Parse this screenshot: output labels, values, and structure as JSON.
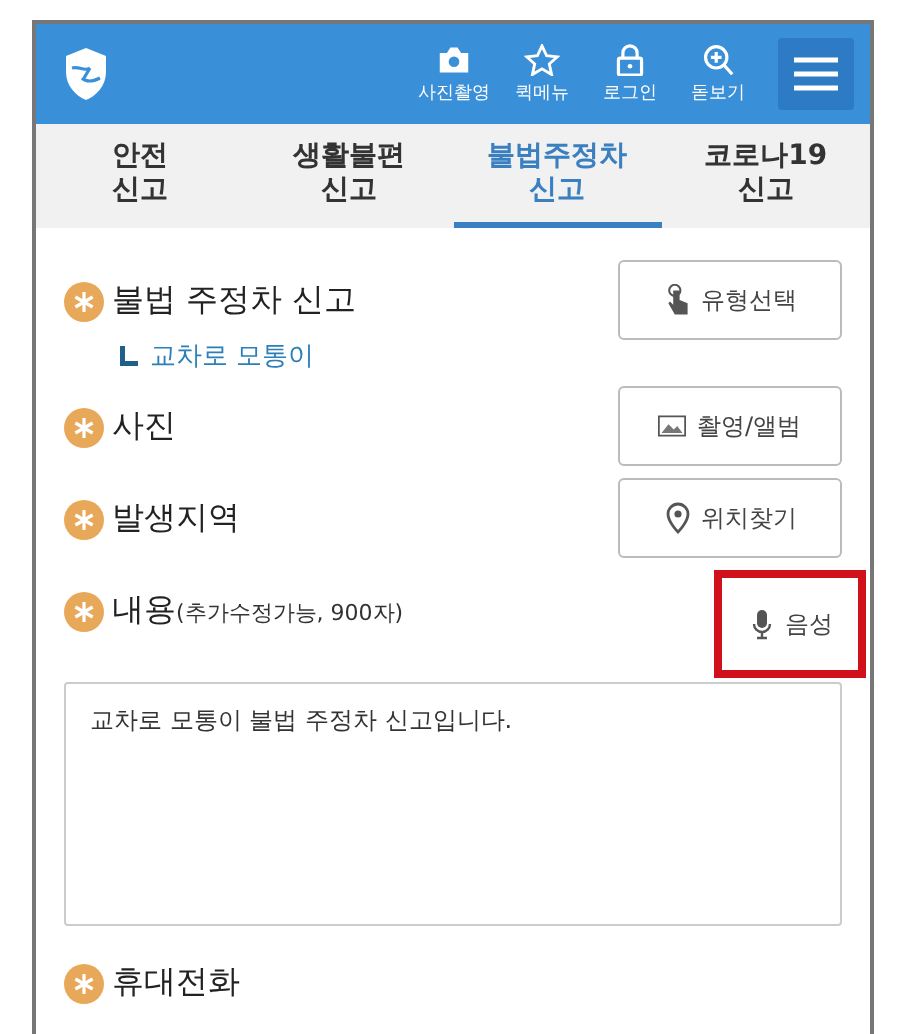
{
  "header": {
    "actions": [
      {
        "kind": "camera",
        "label": "사진촬영"
      },
      {
        "kind": "star",
        "label": "퀵메뉴"
      },
      {
        "kind": "lock",
        "label": "로그인"
      },
      {
        "kind": "zoom",
        "label": "돋보기"
      }
    ]
  },
  "tabs": [
    {
      "line1": "안전",
      "line2": "신고",
      "selected": false
    },
    {
      "line1": "생활불편",
      "line2": "신고",
      "selected": false
    },
    {
      "line1": "불법주정차",
      "line2": "신고",
      "selected": true
    },
    {
      "line1": "코로나19",
      "line2": "신고",
      "selected": false
    }
  ],
  "fields": [
    {
      "label": "불법 주정차 신고",
      "sub": "교차로 모통이",
      "button": {
        "kind": "touch",
        "label": "유형선택",
        "highlighted": false
      }
    },
    {
      "label": "사진",
      "button": {
        "kind": "image",
        "label": "촬영/앨범",
        "highlighted": false
      }
    },
    {
      "label": "발생지역",
      "button": {
        "kind": "pin",
        "label": "위치찾기",
        "highlighted": false
      }
    },
    {
      "label": "내용",
      "note": "(추가수정가능, 900자)",
      "button": {
        "kind": "mic",
        "label": "음성",
        "highlighted": true
      },
      "value": "교차로 모통이 불법 주정차 신고입니다."
    },
    {
      "label": "휴대전화"
    }
  ]
}
